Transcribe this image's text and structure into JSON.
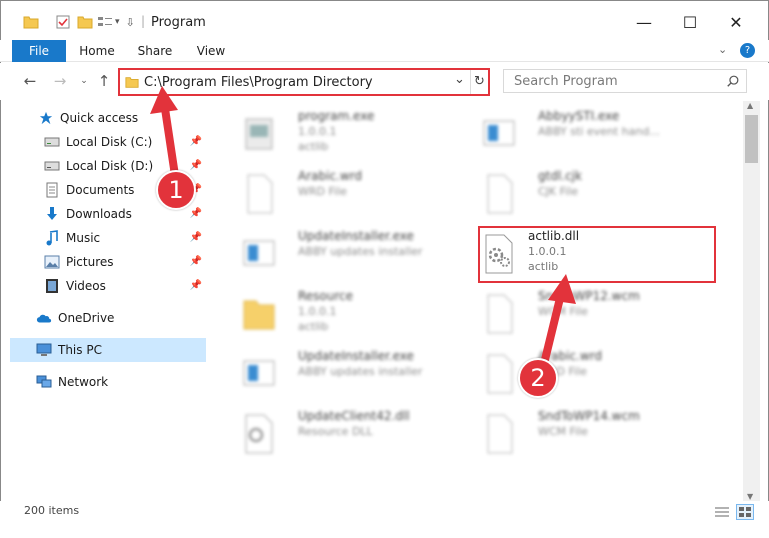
{
  "window": {
    "title": "Program",
    "minimize_glyph": "—",
    "maximize_glyph": "☐",
    "close_glyph": "✕"
  },
  "ribbon": {
    "tabs": [
      "File",
      "Home",
      "Share",
      "View"
    ]
  },
  "address": {
    "path": "C:\\Program Files\\Program Directory",
    "dropdown_glyph": "⌄",
    "refresh_glyph": "↻"
  },
  "search": {
    "placeholder": "Search Program"
  },
  "sidebar": {
    "items": [
      {
        "label": "Quick access",
        "icon": "star-icon",
        "pinned": false
      },
      {
        "label": "Local Disk (C:)",
        "icon": "drive-icon",
        "pinned": true
      },
      {
        "label": "Local Disk (D:)",
        "icon": "drive-icon",
        "pinned": true
      },
      {
        "label": "Documents",
        "icon": "documents-icon",
        "pinned": true
      },
      {
        "label": "Downloads",
        "icon": "download-icon",
        "pinned": true
      },
      {
        "label": "Music",
        "icon": "music-icon",
        "pinned": true
      },
      {
        "label": "Pictures",
        "icon": "pictures-icon",
        "pinned": true
      },
      {
        "label": "Videos",
        "icon": "videos-icon",
        "pinned": true
      },
      {
        "label": "OneDrive",
        "icon": "cloud-icon",
        "pinned": false
      },
      {
        "label": "This PC",
        "icon": "computer-icon",
        "pinned": false,
        "selected": true
      },
      {
        "label": "Network",
        "icon": "network-icon",
        "pinned": false
      }
    ]
  },
  "files": [
    {
      "name": "program.exe",
      "line2": "1.0.0.1",
      "line3": "actlib",
      "type": "exe"
    },
    {
      "name": "AbbyySTI.exe",
      "line2": "ABBY sti event hand...",
      "line3": "",
      "type": "app"
    },
    {
      "name": "Arabic.wrd",
      "line2": "WRD File",
      "line3": "",
      "type": "doc"
    },
    {
      "name": "gtdl.cjk",
      "line2": "CJK File",
      "line3": "",
      "type": "doc"
    },
    {
      "name": "UpdateInstaller.exe",
      "line2": "ABBY updates installer",
      "line3": "",
      "type": "app"
    },
    {
      "name": "actlib.dll",
      "line2": "1.0.0.1",
      "line3": "actlib",
      "type": "dll"
    },
    {
      "name": "Resource",
      "line2": "1.0.0.1",
      "line3": "actlib",
      "type": "folder"
    },
    {
      "name": "SndToWP12.wcm",
      "line2": "WCM File",
      "line3": "",
      "type": "doc"
    },
    {
      "name": "UpdateInstaller.exe",
      "line2": "ABBY updates installer",
      "line3": "",
      "type": "app"
    },
    {
      "name": "Arabic.wrd",
      "line2": "WRD File",
      "line3": "",
      "type": "doc"
    },
    {
      "name": "UpdateClient42.dll",
      "line2": "Resource DLL",
      "line3": "",
      "type": "dll"
    },
    {
      "name": "SndToWP14.wcm",
      "line2": "WCM File",
      "line3": "",
      "type": "doc"
    }
  ],
  "status": {
    "item_count": "200 items"
  },
  "annotations": {
    "step1": "1",
    "step2": "2",
    "accent": "#e2333b"
  },
  "colors": {
    "file_tab": "#1979ca",
    "selected": "#cce8ff",
    "highlight": "#e2333b"
  }
}
